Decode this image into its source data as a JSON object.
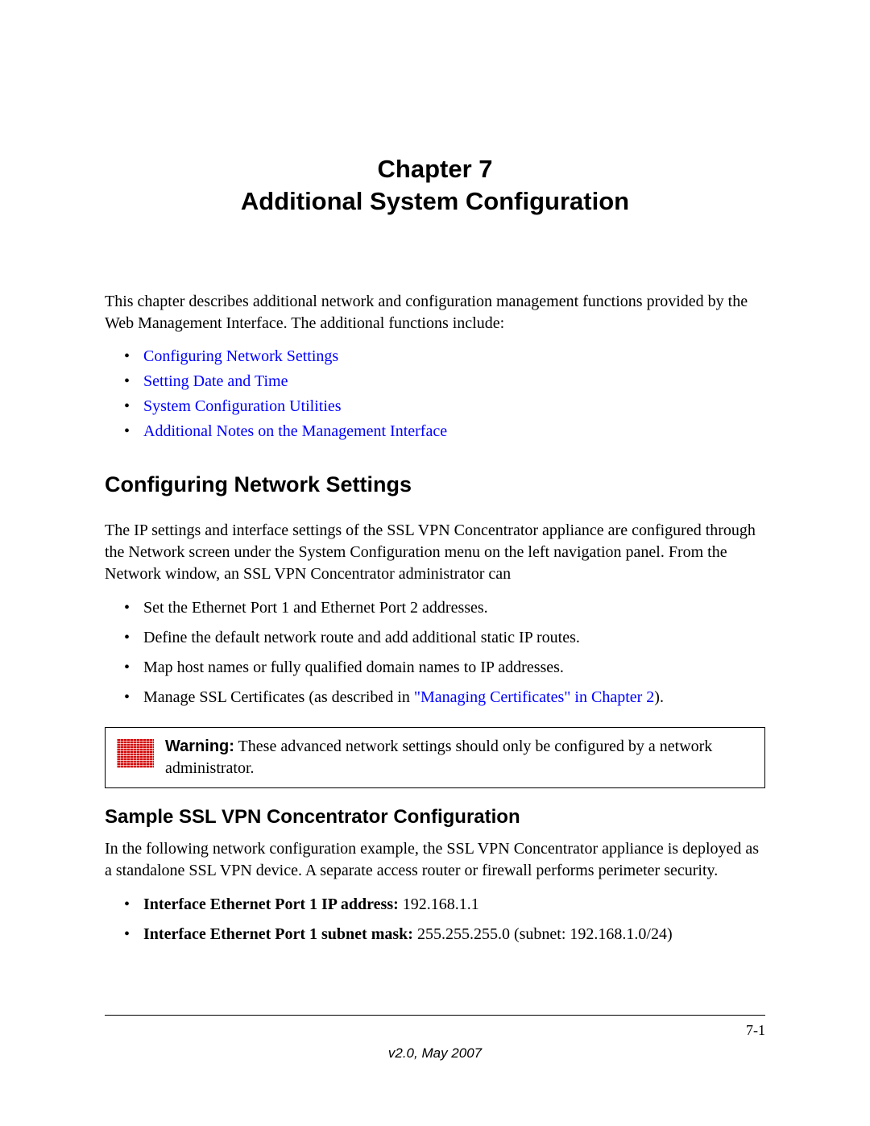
{
  "chapter": {
    "line1": "Chapter 7",
    "line2": "Additional System Configuration"
  },
  "intro": "This chapter describes additional network and configuration management functions provided by the Web Management Interface. The additional functions include:",
  "toc_links": [
    "Configuring Network Settings",
    "Setting Date and Time",
    "System Configuration Utilities",
    "Additional Notes on the Management Interface"
  ],
  "section1": {
    "heading": "Configuring Network Settings",
    "para": "The IP settings and interface settings of the SSL VPN Concentrator appliance are configured through the Network screen under the System Configuration menu on the left navigation panel. From the Network window, an SSL VPN Concentrator administrator can",
    "bullets": [
      {
        "text": "Set the Ethernet Port 1 and Ethernet Port 2 addresses."
      },
      {
        "text": "Define the default network route and add additional static IP routes."
      },
      {
        "text": "Map host names or fully qualified domain names to IP addresses."
      },
      {
        "prefix": "Manage SSL Certificates (as described in ",
        "link": "\"Managing Certificates\" in Chapter 2",
        "suffix": ")."
      }
    ],
    "warning": {
      "label": "Warning:",
      "text": " These advanced network settings should only be configured by a network administrator."
    }
  },
  "section2": {
    "heading": "Sample SSL VPN Concentrator Configuration",
    "para": "In the following network configuration example, the SSL VPN Concentrator appliance is deployed as a standalone SSL VPN device. A separate access router or firewall performs perimeter security.",
    "bullets": [
      {
        "label": "Interface Ethernet Port 1 IP address: ",
        "value": "192.168.1.1"
      },
      {
        "label": "Interface Ethernet Port 1 subnet mask: ",
        "value": "255.255.255.0 (subnet: 192.168.1.0/24)"
      }
    ]
  },
  "footer": {
    "page": "7-1",
    "version": "v2.0, May 2007"
  }
}
